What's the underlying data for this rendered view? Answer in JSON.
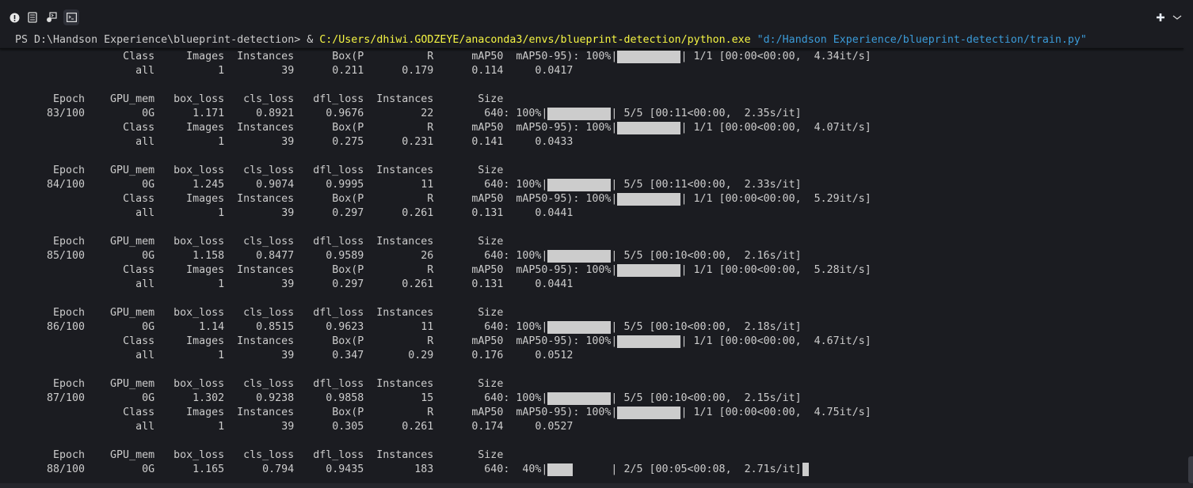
{
  "toolbar": {
    "icons": [
      "alert-icon",
      "notes-icon",
      "remote-icon",
      "terminal-icon"
    ],
    "right_icons": [
      "plus-icon",
      "chevron-down-icon"
    ]
  },
  "prompt": {
    "ps": "PS D:\\Handson Experience\\blueprint-detection> ",
    "amp": "& ",
    "exe": "C:/Users/dhiwi.GODZEYE/anaconda3/envs/blueprint-detection/python.exe",
    "script": "\"d:/Handson Experience/blueprint-detection/train.py\""
  },
  "colors": {
    "background": "#1b1c21",
    "text": "#cccccc",
    "path": "#f5f543",
    "string": "#3b9bd8"
  },
  "train_cols": [
    "Epoch",
    "GPU_mem",
    "box_loss",
    "cls_loss",
    "dfl_loss",
    "Instances",
    "Size"
  ],
  "val_cols": [
    "Class",
    "Images",
    "Instances",
    "Box(P",
    "R",
    "mAP50",
    "mAP50-95)"
  ],
  "blocks": [
    {
      "val": {
        "pct": "100%",
        "progress": 1.0,
        "iter": "1/1",
        "elapsed": "00:00",
        "remaining": "00:00",
        "rate": "4.34it/s",
        "class": "all",
        "images": "1",
        "instances": "39",
        "p": "0.211",
        "r": "0.179",
        "map50": "0.114",
        "map5095": "0.0417"
      }
    },
    {
      "train": {
        "epoch": "83/100",
        "gpu": "0G",
        "box_loss": "1.171",
        "cls_loss": "0.8921",
        "dfl_loss": "0.9676",
        "instances": "22",
        "size": "640",
        "pct": "100%",
        "progress": 1.0,
        "iter": "5/5",
        "elapsed": "00:11",
        "remaining": "00:00",
        "rate": "2.35s/it"
      },
      "val": {
        "pct": "100%",
        "progress": 1.0,
        "iter": "1/1",
        "elapsed": "00:00",
        "remaining": "00:00",
        "rate": "4.07it/s",
        "class": "all",
        "images": "1",
        "instances": "39",
        "p": "0.275",
        "r": "0.231",
        "map50": "0.141",
        "map5095": "0.0433"
      }
    },
    {
      "train": {
        "epoch": "84/100",
        "gpu": "0G",
        "box_loss": "1.245",
        "cls_loss": "0.9074",
        "dfl_loss": "0.9995",
        "instances": "11",
        "size": "640",
        "pct": "100%",
        "progress": 1.0,
        "iter": "5/5",
        "elapsed": "00:11",
        "remaining": "00:00",
        "rate": "2.33s/it"
      },
      "val": {
        "pct": "100%",
        "progress": 1.0,
        "iter": "1/1",
        "elapsed": "00:00",
        "remaining": "00:00",
        "rate": "5.29it/s",
        "class": "all",
        "images": "1",
        "instances": "39",
        "p": "0.297",
        "r": "0.261",
        "map50": "0.131",
        "map5095": "0.0441"
      }
    },
    {
      "train": {
        "epoch": "85/100",
        "gpu": "0G",
        "box_loss": "1.158",
        "cls_loss": "0.8477",
        "dfl_loss": "0.9589",
        "instances": "26",
        "size": "640",
        "pct": "100%",
        "progress": 1.0,
        "iter": "5/5",
        "elapsed": "00:10",
        "remaining": "00:00",
        "rate": "2.16s/it"
      },
      "val": {
        "pct": "100%",
        "progress": 1.0,
        "iter": "1/1",
        "elapsed": "00:00",
        "remaining": "00:00",
        "rate": "5.28it/s",
        "class": "all",
        "images": "1",
        "instances": "39",
        "p": "0.297",
        "r": "0.261",
        "map50": "0.131",
        "map5095": "0.0441"
      }
    },
    {
      "train": {
        "epoch": "86/100",
        "gpu": "0G",
        "box_loss": "1.14",
        "cls_loss": "0.8515",
        "dfl_loss": "0.9623",
        "instances": "11",
        "size": "640",
        "pct": "100%",
        "progress": 1.0,
        "iter": "5/5",
        "elapsed": "00:10",
        "remaining": "00:00",
        "rate": "2.18s/it"
      },
      "val": {
        "pct": "100%",
        "progress": 1.0,
        "iter": "1/1",
        "elapsed": "00:00",
        "remaining": "00:00",
        "rate": "4.67it/s",
        "class": "all",
        "images": "1",
        "instances": "39",
        "p": "0.347",
        "r": "0.29",
        "map50": "0.176",
        "map5095": "0.0512"
      }
    },
    {
      "train": {
        "epoch": "87/100",
        "gpu": "0G",
        "box_loss": "1.302",
        "cls_loss": "0.9238",
        "dfl_loss": "0.9858",
        "instances": "15",
        "size": "640",
        "pct": "100%",
        "progress": 1.0,
        "iter": "5/5",
        "elapsed": "00:10",
        "remaining": "00:00",
        "rate": "2.15s/it"
      },
      "val": {
        "pct": "100%",
        "progress": 1.0,
        "iter": "1/1",
        "elapsed": "00:00",
        "remaining": "00:00",
        "rate": "4.75it/s",
        "class": "all",
        "images": "1",
        "instances": "39",
        "p": "0.305",
        "r": "0.261",
        "map50": "0.174",
        "map5095": "0.0527"
      }
    },
    {
      "train": {
        "epoch": "88/100",
        "gpu": "0G",
        "box_loss": "1.165",
        "cls_loss": "0.794",
        "dfl_loss": "0.9435",
        "instances": "183",
        "size": "640",
        "pct": "40%",
        "progress": 0.4,
        "iter": "2/5",
        "elapsed": "00:05",
        "remaining": "00:08",
        "rate": "2.71s/it"
      }
    }
  ]
}
